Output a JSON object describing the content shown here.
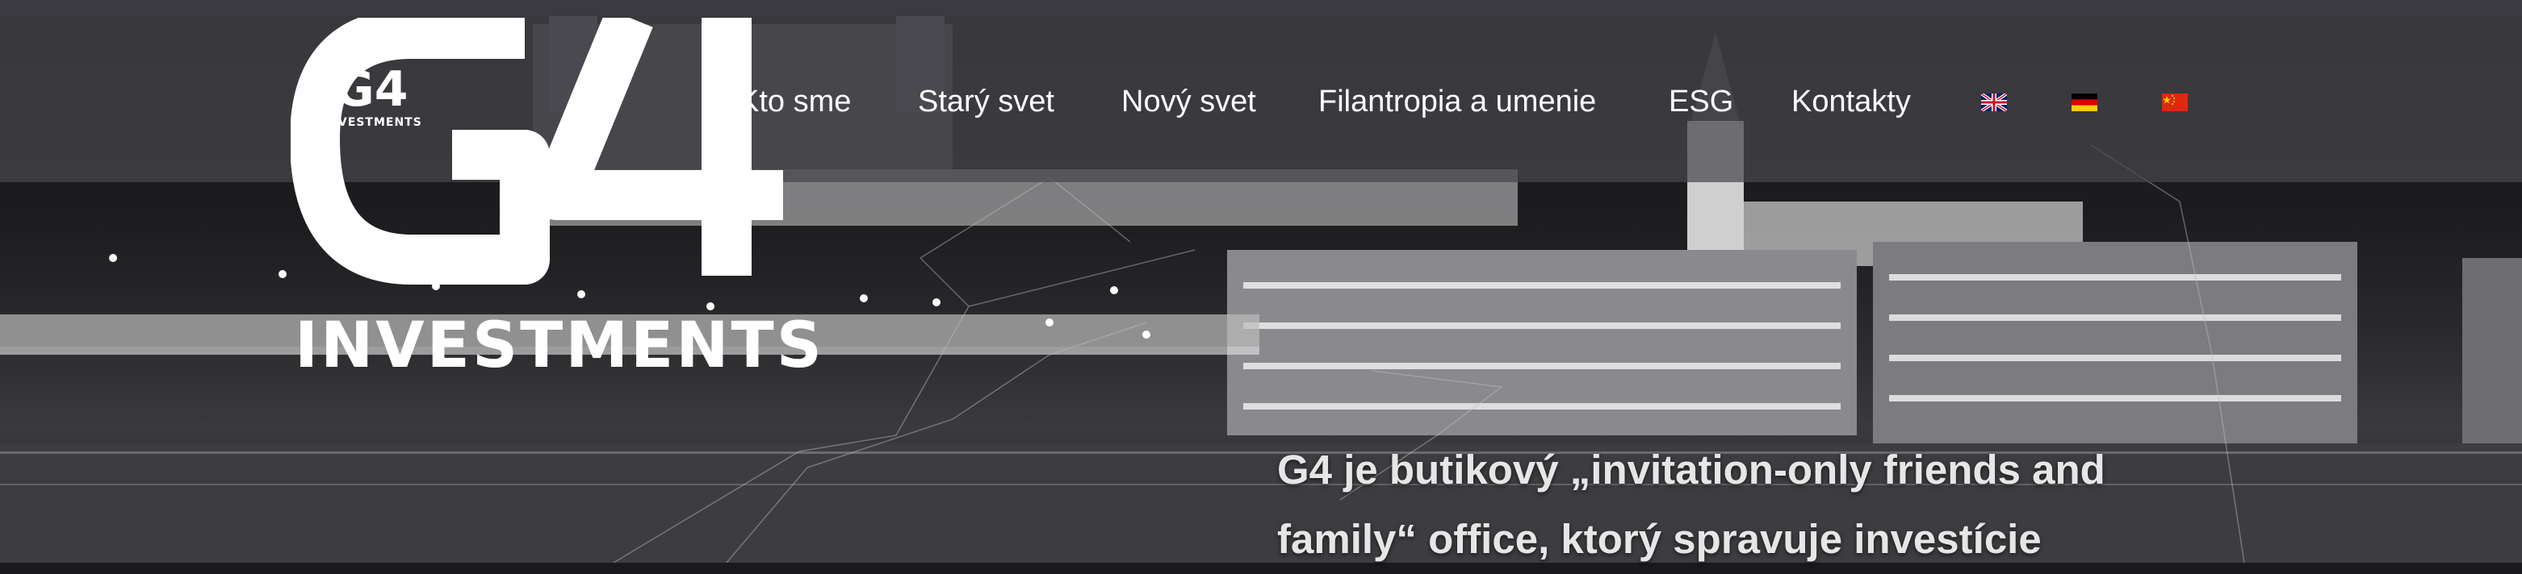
{
  "logo": {
    "small_mark": "G4",
    "small_word": "INVESTMENTS",
    "big_mark": "G4",
    "big_word": "INVESTMENTS"
  },
  "nav": {
    "items": [
      {
        "label": "Kto sme"
      },
      {
        "label": "Starý svet"
      },
      {
        "label": "Nový svet"
      },
      {
        "label": "Filantropia a umenie"
      },
      {
        "label": "ESG"
      },
      {
        "label": "Kontakty"
      }
    ],
    "languages": [
      {
        "name": "english-flag-icon"
      },
      {
        "name": "german-flag-icon"
      },
      {
        "name": "chinese-flag-icon"
      }
    ]
  },
  "hero": {
    "tagline_line1": "G4 je butikový „invitation-only friends and",
    "tagline_line2": "family“ office, ktorý spravuje investície"
  },
  "colors": {
    "nav_background": "#46464c",
    "text": "#ffffff",
    "tagline": "#e6e6e6"
  }
}
